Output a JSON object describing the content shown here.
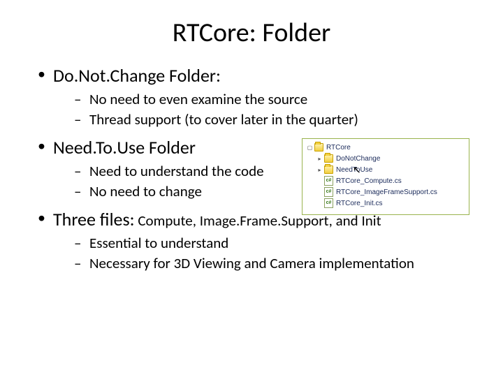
{
  "title": "RTCore: Folder",
  "bullets": [
    {
      "label": "Do.Not.Change Folder:",
      "sub": [
        "No need to even examine the source",
        "Thread support (to cover later in the quarter)"
      ]
    },
    {
      "label": "Need.To.Use Folder",
      "sub": [
        "Need to understand the code",
        "No need to change"
      ]
    },
    {
      "label": "Three files:",
      "label_tail": " Compute, Image.Frame.Support, and Init",
      "sub": [
        "Essential to understand",
        "Necessary for 3D Viewing and Camera implementation"
      ]
    }
  ],
  "tree": {
    "root": "RTCore",
    "folders": [
      "DoNotChange",
      "NeedToUse"
    ],
    "files": [
      "RTCore_Compute.cs",
      "RTCore_ImageFrameSupport.cs",
      "RTCore_Init.cs"
    ]
  }
}
